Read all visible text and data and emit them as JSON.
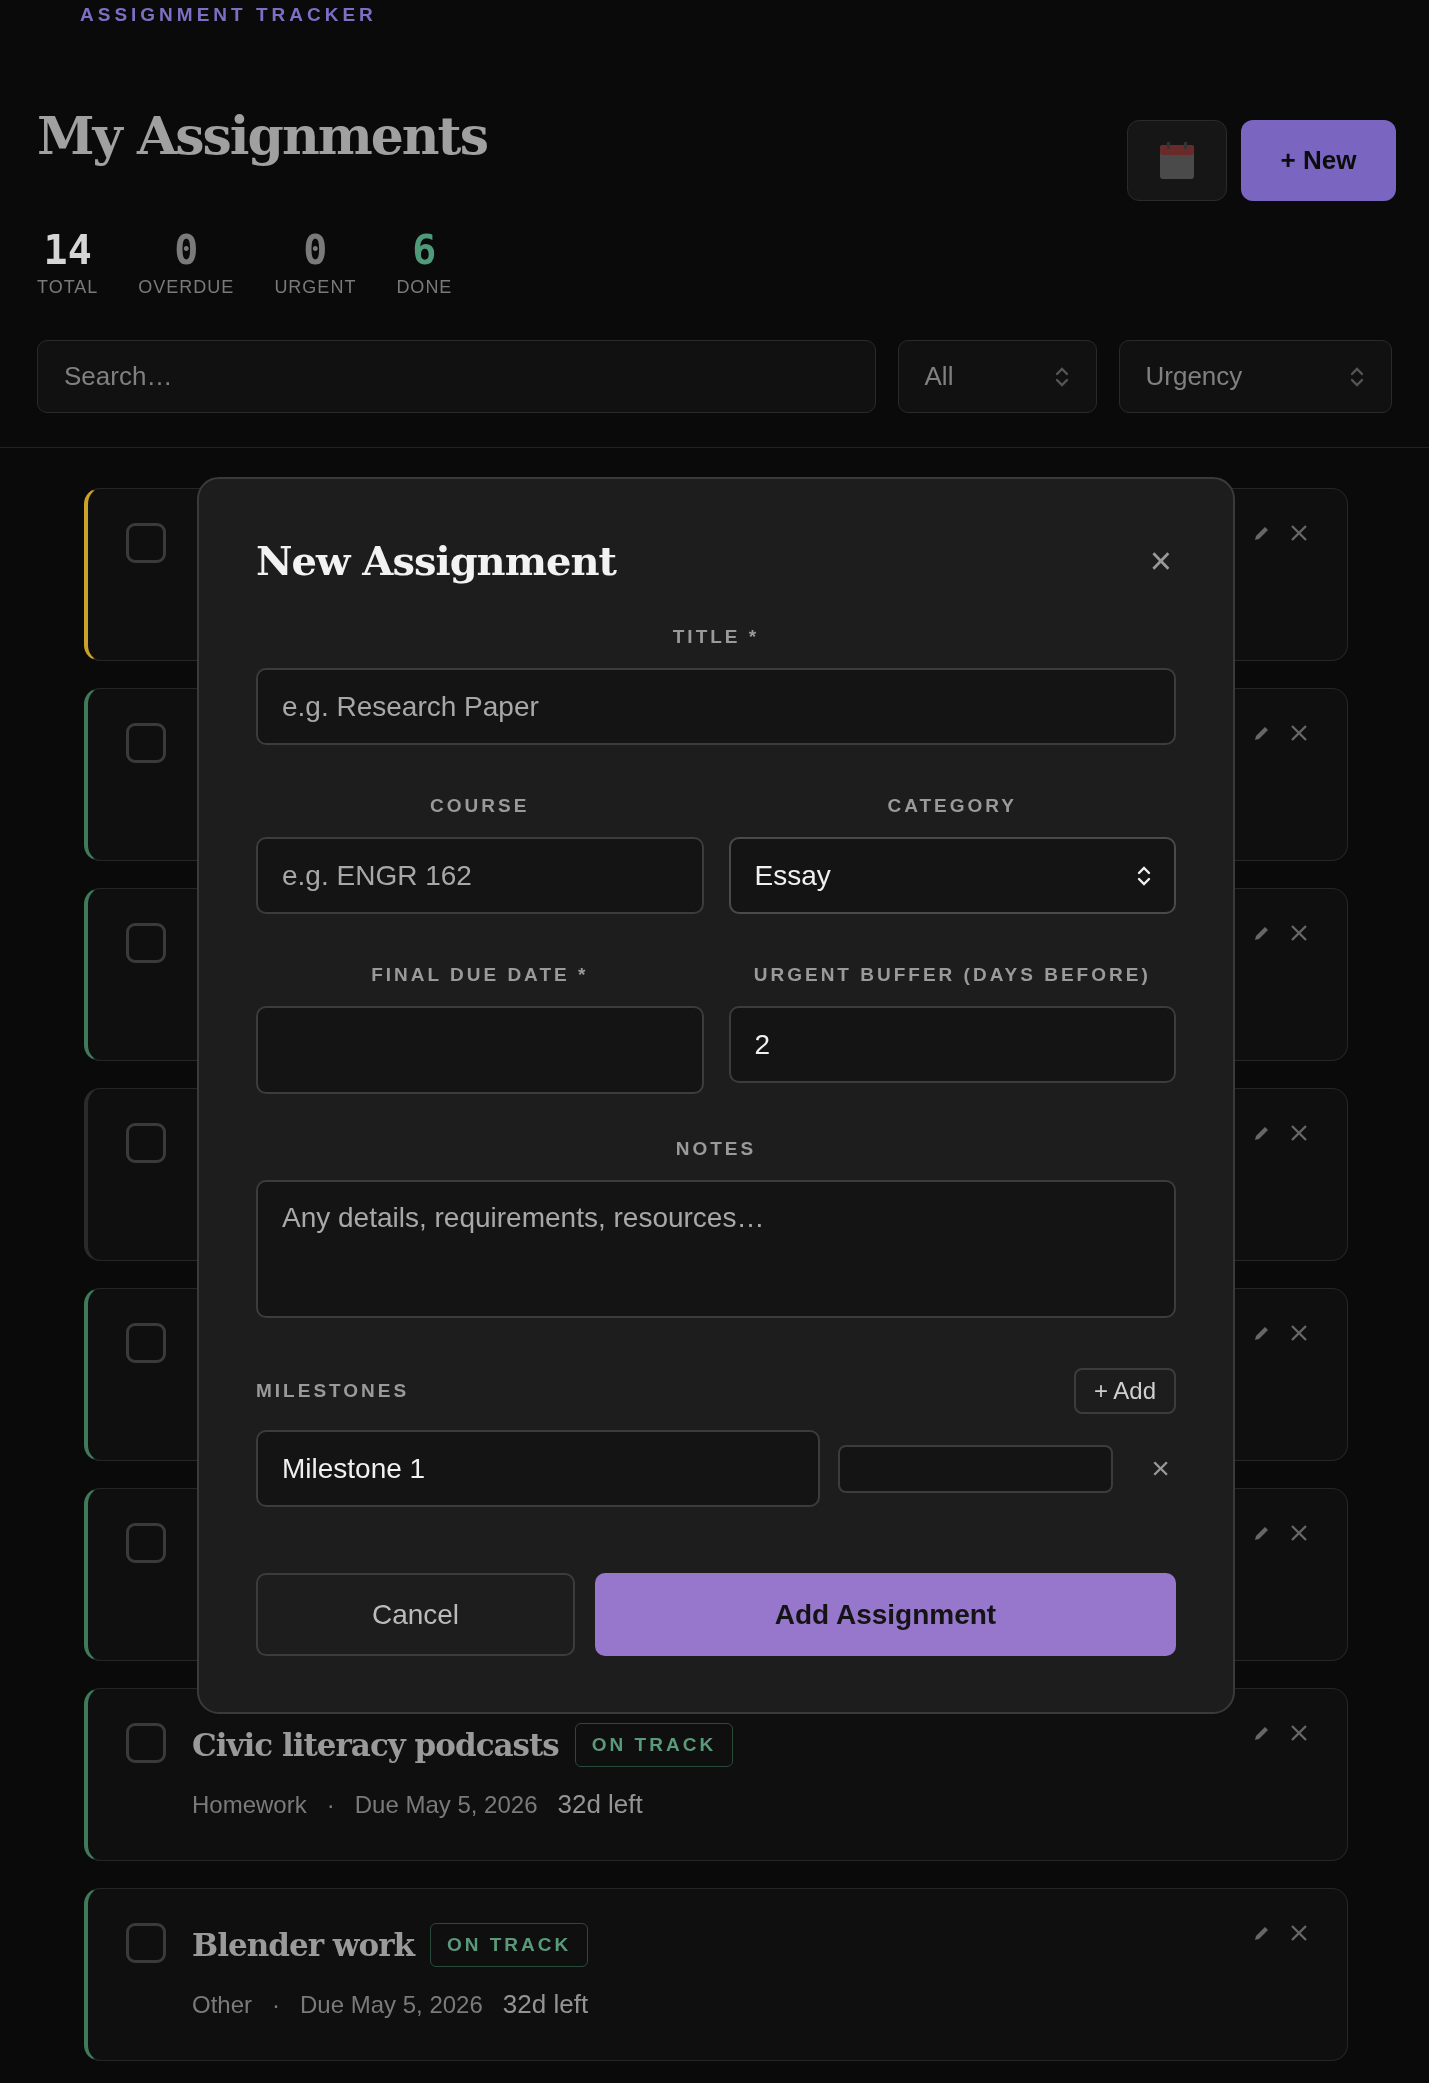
{
  "header": {
    "eyebrow": "ASSIGNMENT TRACKER",
    "title": "My Assignments",
    "new_button": "+ New"
  },
  "stats": [
    {
      "value": "14",
      "label": "TOTAL",
      "color": "#d6d6d6"
    },
    {
      "value": "0",
      "label": "OVERDUE",
      "color": "#7a7a7a"
    },
    {
      "value": "0",
      "label": "URGENT",
      "color": "#7a7a7a"
    },
    {
      "value": "6",
      "label": "DONE",
      "color": "#4f9a78"
    }
  ],
  "filters": {
    "search_placeholder": "Search…",
    "status": "All",
    "sort": "Urgency"
  },
  "assignments": [
    {
      "color": "#c9a227",
      "checked": false
    },
    {
      "color": "#3f7a5a",
      "checked": false
    },
    {
      "color": "#3f7a5a",
      "checked": false
    },
    {
      "color": "#2a2a2a",
      "checked": false
    },
    {
      "color": "#3f7a5a",
      "checked": false
    },
    {
      "color": "#3f7a5a",
      "checked": false
    },
    {
      "color": "#3f7a5a",
      "checked": false,
      "title": "Civic literacy podcasts",
      "status": "ON TRACK",
      "category": "Homework",
      "separator": "·",
      "due": "Due May 5, 2026",
      "remaining": "32d left"
    },
    {
      "color": "#3f7a5a",
      "checked": false,
      "title": "Blender work",
      "status": "ON TRACK",
      "category": "Other",
      "separator": "·",
      "due": "Due May 5, 2026",
      "remaining": "32d left"
    }
  ],
  "modal": {
    "title": "New Assignment",
    "close": "×",
    "title_field": {
      "label": "TITLE *",
      "placeholder": "e.g. Research Paper"
    },
    "course_field": {
      "label": "COURSE",
      "placeholder": "e.g. ENGR 162"
    },
    "category_field": {
      "label": "CATEGORY",
      "value": "Essay"
    },
    "due_field": {
      "label": "FINAL DUE DATE *"
    },
    "buffer_field": {
      "label": "URGENT BUFFER (DAYS BEFORE)",
      "value": "2"
    },
    "notes_field": {
      "label": "NOTES",
      "placeholder": "Any details, requirements, resources…"
    },
    "milestones": {
      "label": "MILESTONES",
      "add_button": "+ Add",
      "items": [
        {
          "name": "Milestone 1",
          "remove": "×"
        }
      ]
    },
    "cancel_button": "Cancel",
    "submit_button": "Add Assignment"
  }
}
